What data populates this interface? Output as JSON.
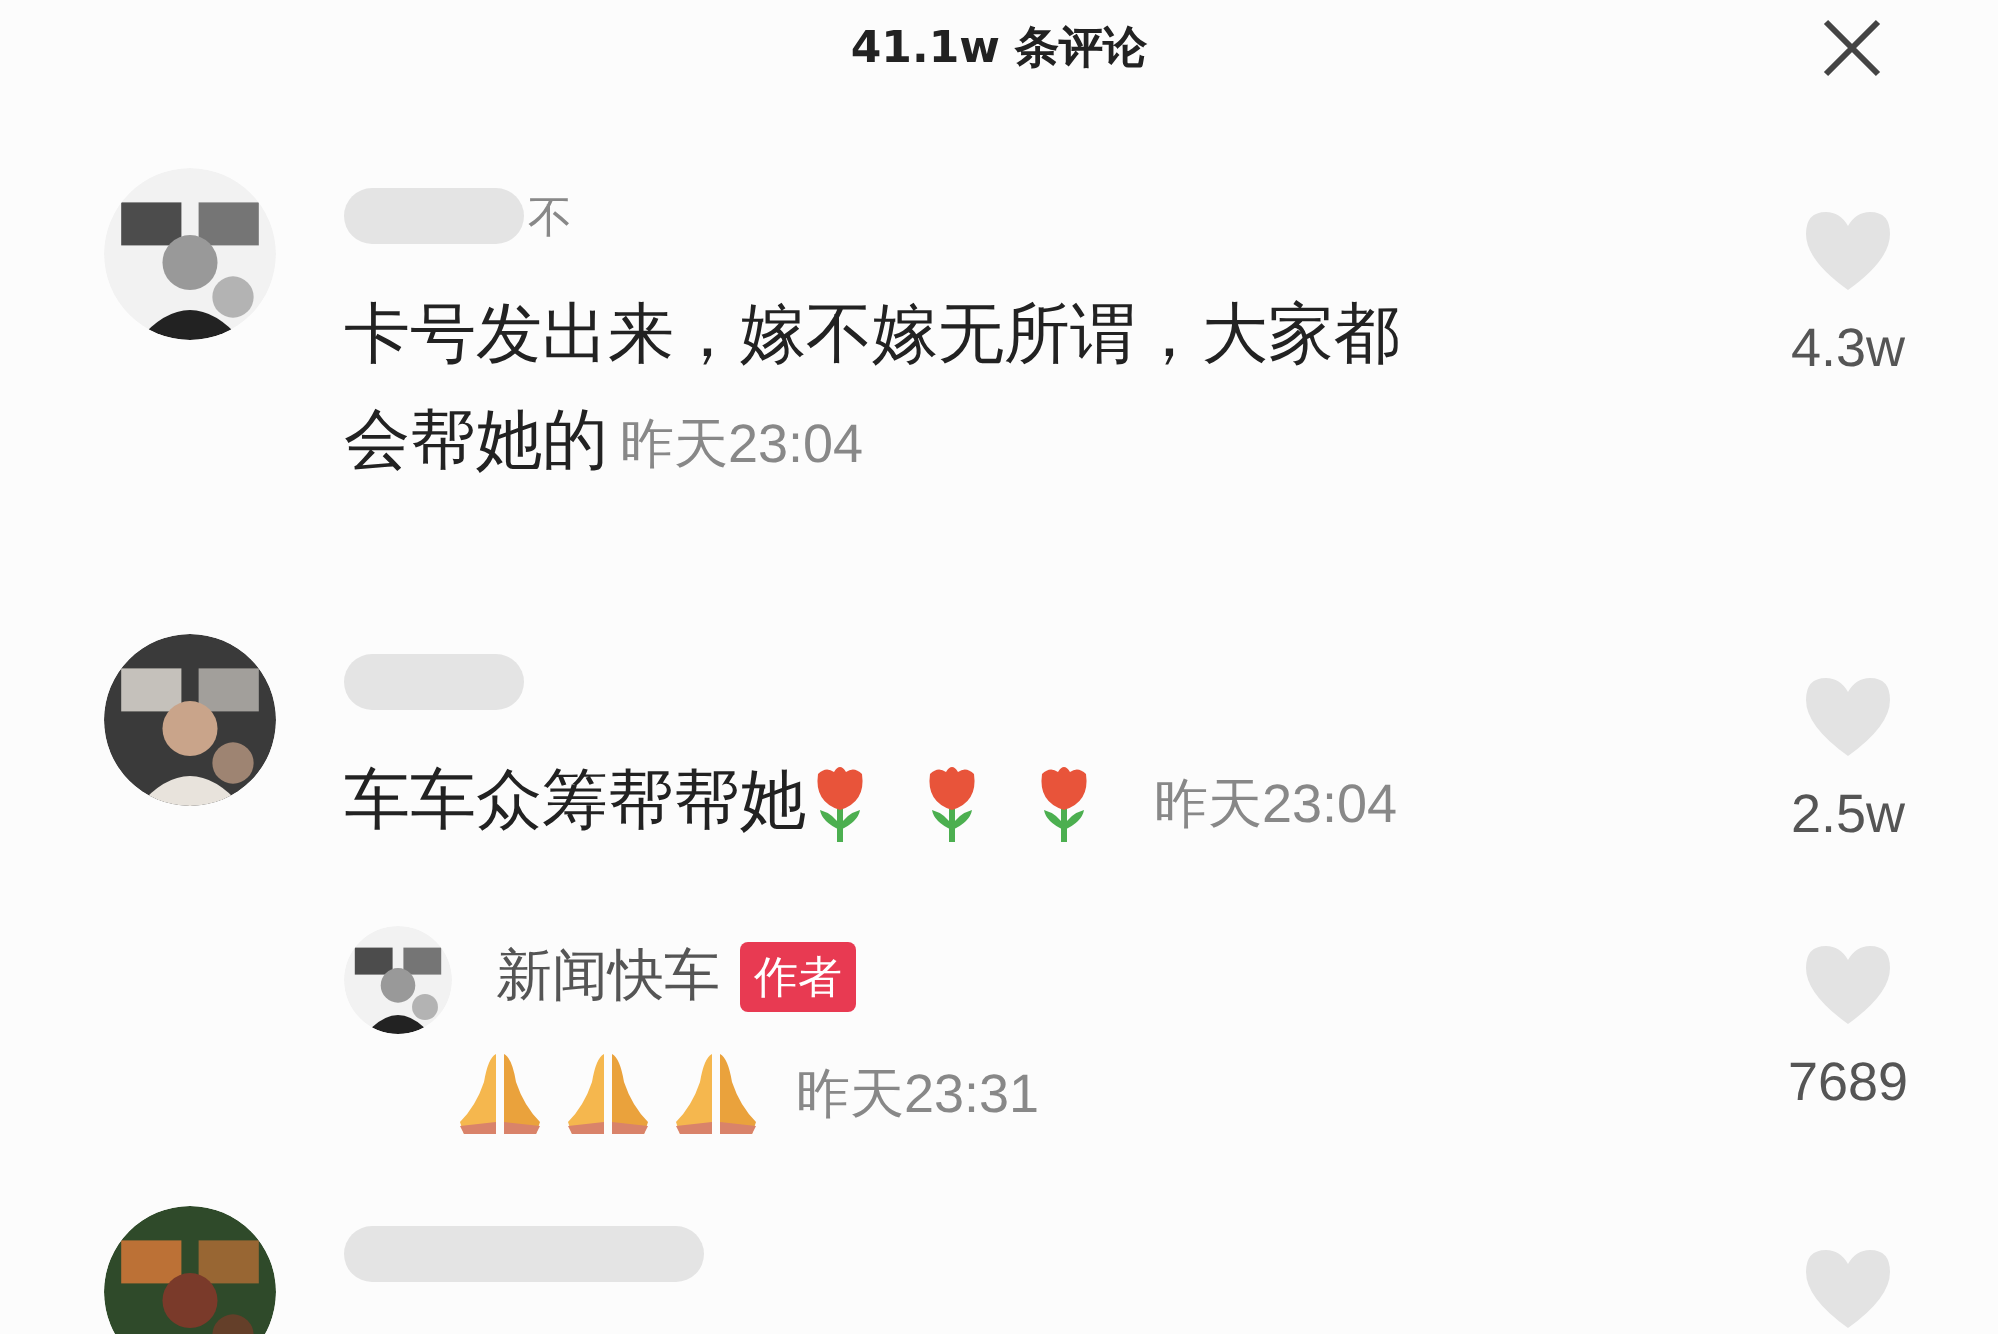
{
  "header": {
    "title": "41.1w 条评论"
  },
  "comments": [
    {
      "name_redacted": true,
      "name_fragment": "不",
      "text_lines": [
        "卡号发出来，嫁不嫁无所谓，大家都",
        "会帮她的"
      ],
      "time": "昨天23:04",
      "likes": "4.3w"
    },
    {
      "name_redacted": true,
      "text_lines": [
        "车车众筹帮帮她"
      ],
      "emojis": [
        {
          "kind": "tulip"
        },
        {
          "kind": "tulip"
        },
        {
          "kind": "tulip"
        }
      ],
      "time": "昨天23:04",
      "likes": "2.5w",
      "replies": [
        {
          "name": "新闻快车",
          "badge": "作者",
          "emojis": [
            {
              "kind": "praying-hands"
            },
            {
              "kind": "praying-hands"
            },
            {
              "kind": "praying-hands"
            }
          ],
          "time": "昨天23:31",
          "likes": "7689"
        }
      ]
    },
    {
      "name_redacted": true
    }
  ]
}
